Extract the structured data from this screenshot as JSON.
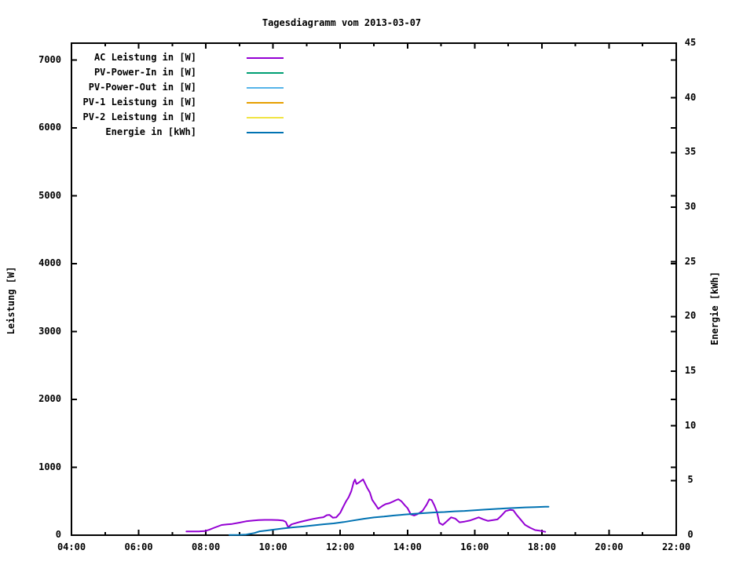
{
  "chart_data": {
    "type": "line",
    "title": "Tagesdiagramm vom 2013-03-07",
    "background_color": "#ffffff",
    "border_color": "#000000",
    "grid": false,
    "legend_position": "top-left-inside",
    "x_axis": {
      "range_hours": [
        4,
        22
      ],
      "major_tick_hours": [
        4,
        6,
        8,
        10,
        12,
        14,
        16,
        18,
        20,
        22
      ],
      "tick_labels": [
        "04:00",
        "06:00",
        "08:00",
        "10:00",
        "12:00",
        "14:00",
        "16:00",
        "18:00",
        "20:00",
        "22:00"
      ],
      "minor_ticks_every_hours": 1
    },
    "y_axis_left": {
      "label": "Leistung [W]",
      "range": [
        0,
        7250
      ],
      "ticks": [
        0,
        1000,
        2000,
        3000,
        4000,
        5000,
        6000,
        7000
      ]
    },
    "y_axis_right": {
      "label": "Energie [kWh]",
      "range": [
        0,
        45
      ],
      "ticks": [
        0,
        5,
        10,
        15,
        20,
        25,
        30,
        35,
        40,
        45
      ]
    },
    "series": [
      {
        "name": "AC Leistung in [W]",
        "color": "#9400d3",
        "axis": "left",
        "points": [
          [
            7.42,
            55
          ],
          [
            7.6,
            55
          ],
          [
            7.8,
            55
          ],
          [
            7.97,
            60
          ],
          [
            8.1,
            80
          ],
          [
            8.25,
            110
          ],
          [
            8.47,
            150
          ],
          [
            8.63,
            158
          ],
          [
            8.78,
            165
          ],
          [
            9.0,
            185
          ],
          [
            9.2,
            205
          ],
          [
            9.4,
            215
          ],
          [
            9.57,
            222
          ],
          [
            9.75,
            225
          ],
          [
            9.95,
            225
          ],
          [
            10.15,
            222
          ],
          [
            10.3,
            215
          ],
          [
            10.38,
            195
          ],
          [
            10.45,
            118
          ],
          [
            10.55,
            160
          ],
          [
            10.65,
            175
          ],
          [
            10.8,
            195
          ],
          [
            11.0,
            218
          ],
          [
            11.2,
            240
          ],
          [
            11.37,
            255
          ],
          [
            11.5,
            265
          ],
          [
            11.6,
            295
          ],
          [
            11.68,
            300
          ],
          [
            11.78,
            258
          ],
          [
            11.88,
            262
          ],
          [
            12.0,
            330
          ],
          [
            12.1,
            430
          ],
          [
            12.17,
            497
          ],
          [
            12.25,
            560
          ],
          [
            12.33,
            650
          ],
          [
            12.4,
            780
          ],
          [
            12.44,
            820
          ],
          [
            12.48,
            755
          ],
          [
            12.55,
            775
          ],
          [
            12.62,
            800
          ],
          [
            12.68,
            822
          ],
          [
            12.73,
            770
          ],
          [
            12.8,
            700
          ],
          [
            12.88,
            630
          ],
          [
            12.95,
            520
          ],
          [
            13.05,
            450
          ],
          [
            13.13,
            388
          ],
          [
            13.25,
            430
          ],
          [
            13.35,
            458
          ],
          [
            13.45,
            470
          ],
          [
            13.55,
            490
          ],
          [
            13.65,
            515
          ],
          [
            13.73,
            530
          ],
          [
            13.82,
            500
          ],
          [
            13.92,
            440
          ],
          [
            14.0,
            400
          ],
          [
            14.1,
            305
          ],
          [
            14.2,
            290
          ],
          [
            14.3,
            310
          ],
          [
            14.45,
            358
          ],
          [
            14.57,
            450
          ],
          [
            14.65,
            528
          ],
          [
            14.72,
            518
          ],
          [
            14.8,
            440
          ],
          [
            14.88,
            340
          ],
          [
            14.95,
            180
          ],
          [
            15.05,
            152
          ],
          [
            15.15,
            195
          ],
          [
            15.3,
            262
          ],
          [
            15.42,
            245
          ],
          [
            15.55,
            190
          ],
          [
            15.7,
            200
          ],
          [
            15.85,
            215
          ],
          [
            16.0,
            240
          ],
          [
            16.12,
            262
          ],
          [
            16.25,
            235
          ],
          [
            16.4,
            210
          ],
          [
            16.55,
            222
          ],
          [
            16.68,
            232
          ],
          [
            16.8,
            290
          ],
          [
            16.92,
            355
          ],
          [
            17.05,
            372
          ],
          [
            17.15,
            368
          ],
          [
            17.25,
            300
          ],
          [
            17.35,
            240
          ],
          [
            17.5,
            152
          ],
          [
            17.65,
            110
          ],
          [
            17.8,
            75
          ],
          [
            17.95,
            65
          ],
          [
            18.1,
            50
          ]
        ]
      },
      {
        "name": "PV-Power-In in [W]",
        "color": "#009e73",
        "axis": "left",
        "points": []
      },
      {
        "name": "PV-Power-Out in [W]",
        "color": "#56b4e9",
        "axis": "left",
        "points": []
      },
      {
        "name": "PV-1 Leistung in [W]",
        "color": "#e69f00",
        "axis": "left",
        "points": []
      },
      {
        "name": "PV-2 Leistung in [W]",
        "color": "#f0e442",
        "axis": "left",
        "points": []
      },
      {
        "name": "Energie in [kWh]",
        "color": "#0072b2",
        "axis": "right",
        "points": [
          [
            8.7,
            0.02
          ],
          [
            9.0,
            0.03
          ],
          [
            9.2,
            0.06
          ],
          [
            9.45,
            0.2
          ],
          [
            9.6,
            0.35
          ],
          [
            9.8,
            0.42
          ],
          [
            10.0,
            0.5
          ],
          [
            10.3,
            0.62
          ],
          [
            10.6,
            0.72
          ],
          [
            10.9,
            0.8
          ],
          [
            11.2,
            0.9
          ],
          [
            11.5,
            1.0
          ],
          [
            11.8,
            1.08
          ],
          [
            12.1,
            1.2
          ],
          [
            12.4,
            1.35
          ],
          [
            12.7,
            1.5
          ],
          [
            13.0,
            1.62
          ],
          [
            13.3,
            1.7
          ],
          [
            13.6,
            1.8
          ],
          [
            13.9,
            1.88
          ],
          [
            14.2,
            1.95
          ],
          [
            14.5,
            2.02
          ],
          [
            14.8,
            2.08
          ],
          [
            15.1,
            2.12
          ],
          [
            15.4,
            2.18
          ],
          [
            15.7,
            2.22
          ],
          [
            16.0,
            2.28
          ],
          [
            16.3,
            2.34
          ],
          [
            16.6,
            2.4
          ],
          [
            16.9,
            2.45
          ],
          [
            17.2,
            2.5
          ],
          [
            17.5,
            2.54
          ],
          [
            17.8,
            2.57
          ],
          [
            18.1,
            2.6
          ],
          [
            18.2,
            2.6
          ]
        ]
      }
    ]
  }
}
